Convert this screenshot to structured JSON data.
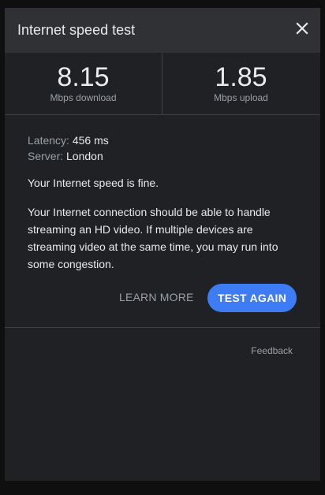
{
  "dialog": {
    "title": "Internet speed test",
    "close_icon": "close-icon"
  },
  "stats": {
    "download": {
      "value": "8.15",
      "unit": "Mbps download"
    },
    "upload": {
      "value": "1.85",
      "unit": "Mbps upload"
    }
  },
  "details": {
    "latency_label": "Latency:",
    "latency_value": "456 ms",
    "server_label": "Server:",
    "server_value": "London"
  },
  "result": {
    "verdict": "Your Internet speed is fine.",
    "description": "Your Internet connection should be able to handle streaming an HD video. If multiple devices are streaming video at the same time, you may run into some congestion."
  },
  "actions": {
    "learn_more": "LEARN MORE",
    "test_again": "TEST AGAIN"
  },
  "footer": {
    "feedback": "Feedback"
  },
  "colors": {
    "background": "#202124",
    "header": "#303134",
    "accent": "#3d7cf4",
    "muted_text": "#9aa0a6"
  }
}
